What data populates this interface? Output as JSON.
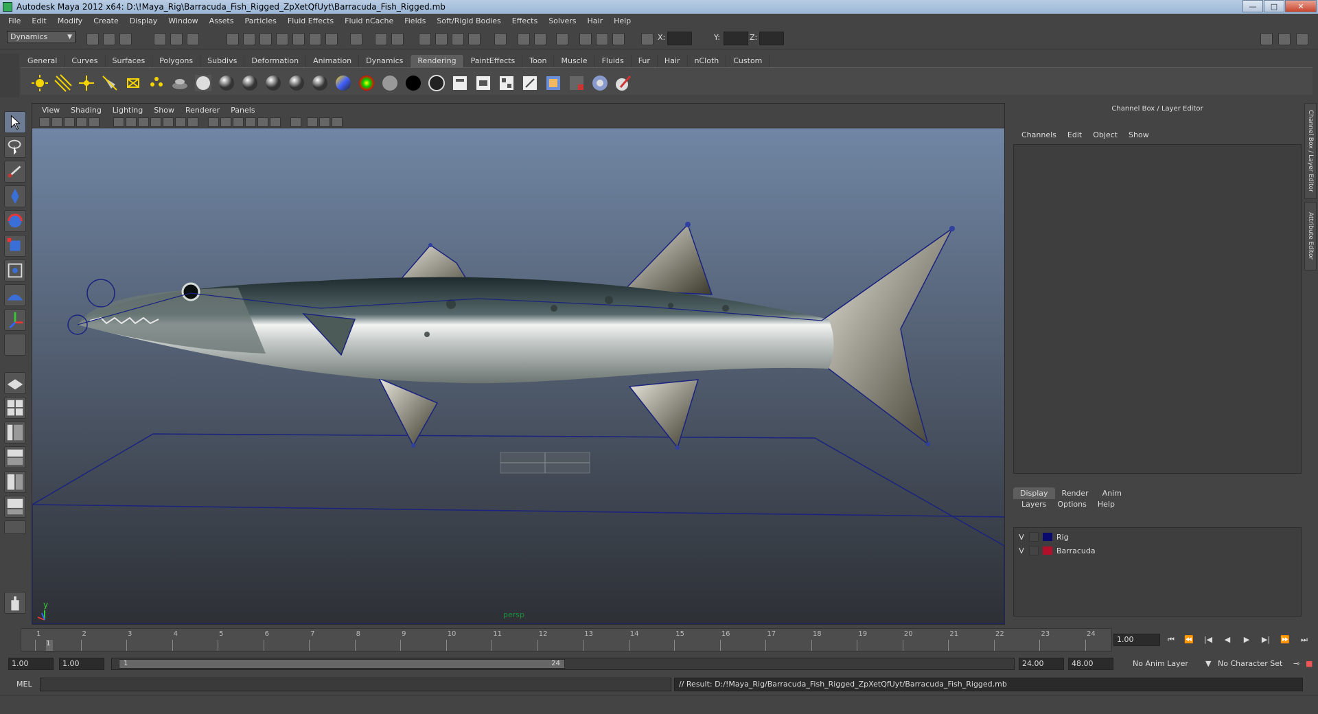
{
  "window": {
    "title": "Autodesk Maya 2012 x64: D:\\!Maya_Rig\\Barracuda_Fish_Rigged_ZpXetQfUyt\\Barracuda_Fish_Rigged.mb",
    "controls": {
      "minimize": "—",
      "maximize": "□",
      "close": "✕"
    }
  },
  "menubar": [
    "File",
    "Edit",
    "Modify",
    "Create",
    "Display",
    "Window",
    "Assets",
    "Particles",
    "Fluid Effects",
    "Fluid nCache",
    "Fields",
    "Soft/Rigid Bodies",
    "Effects",
    "Solvers",
    "Hair",
    "Help"
  ],
  "statusline": {
    "mode": "Dynamics",
    "x_label": "X:",
    "y_label": "Y:",
    "z_label": "Z:"
  },
  "shelf": {
    "tabs": [
      "General",
      "Curves",
      "Surfaces",
      "Polygons",
      "Subdivs",
      "Deformation",
      "Animation",
      "Dynamics",
      "Rendering",
      "PaintEffects",
      "Toon",
      "Muscle",
      "Fluids",
      "Fur",
      "Hair",
      "nCloth",
      "Custom"
    ],
    "active_tab": "Rendering",
    "icons": [
      "ambient-light-icon",
      "directional-light-icon",
      "point-light-icon",
      "spot-light-icon",
      "area-light-icon",
      "volume-light-icon",
      "ibl-icon",
      "sphere-material-icon",
      "blinn-icon",
      "lambert-icon",
      "phong-icon",
      "phonge-icon",
      "anisotropic-icon",
      "ramp-shader-icon",
      "layered-shader-icon",
      "surface-shader-icon",
      "use-background-icon",
      "shading-map-icon",
      "hypershade-icon",
      "render-view-icon",
      "render-settings-icon",
      "ipr-icon",
      "batch-render-icon",
      "render-layer-icon",
      "mental-ray-icon",
      "paint-canvas-icon"
    ]
  },
  "viewport": {
    "menu": [
      "View",
      "Shading",
      "Lighting",
      "Show",
      "Renderer",
      "Panels"
    ],
    "camera_label": "persp",
    "axis_y": "y",
    "axis_x": "x"
  },
  "right_panel": {
    "title": "Channel Box / Layer Editor",
    "menu": [
      "Channels",
      "Edit",
      "Object",
      "Show"
    ],
    "layer_tabs": [
      "Display",
      "Render",
      "Anim"
    ],
    "active_layer_tab": "Display",
    "layer_menu": [
      "Layers",
      "Options",
      "Help"
    ],
    "layers": [
      {
        "visible": "V",
        "name": "Rig",
        "color": "#0a0a6e"
      },
      {
        "visible": "V",
        "name": "Barracuda",
        "color": "#b0102a"
      }
    ],
    "side_tabs": [
      "Channel Box / Layer Editor",
      "Attribute Editor"
    ]
  },
  "timeslider": {
    "ticks": [
      "1",
      "2",
      "3",
      "4",
      "5",
      "6",
      "7",
      "8",
      "9",
      "10",
      "11",
      "12",
      "13",
      "14",
      "15",
      "16",
      "17",
      "18",
      "19",
      "20",
      "21",
      "22",
      "23",
      "24"
    ],
    "current_frame": "1",
    "current_time": "1.00"
  },
  "rangeslider": {
    "start_time": "1.00",
    "playback_start": "1.00",
    "range_start": "1",
    "range_end": "24",
    "playback_end": "24.00",
    "end_time": "48.00",
    "anim_layer": "No Anim Layer",
    "character_set": "No Character Set"
  },
  "cmdline": {
    "label": "MEL",
    "result": "// Result: D:/!Maya_Rig/Barracuda_Fish_Rigged_ZpXetQfUyt/Barracuda_Fish_Rigged.mb"
  },
  "colors": {
    "accent": "#6d7c92",
    "rig_wire": "#1a237e",
    "viewport_top": "#7086a4",
    "viewport_bottom": "#2d3035"
  }
}
